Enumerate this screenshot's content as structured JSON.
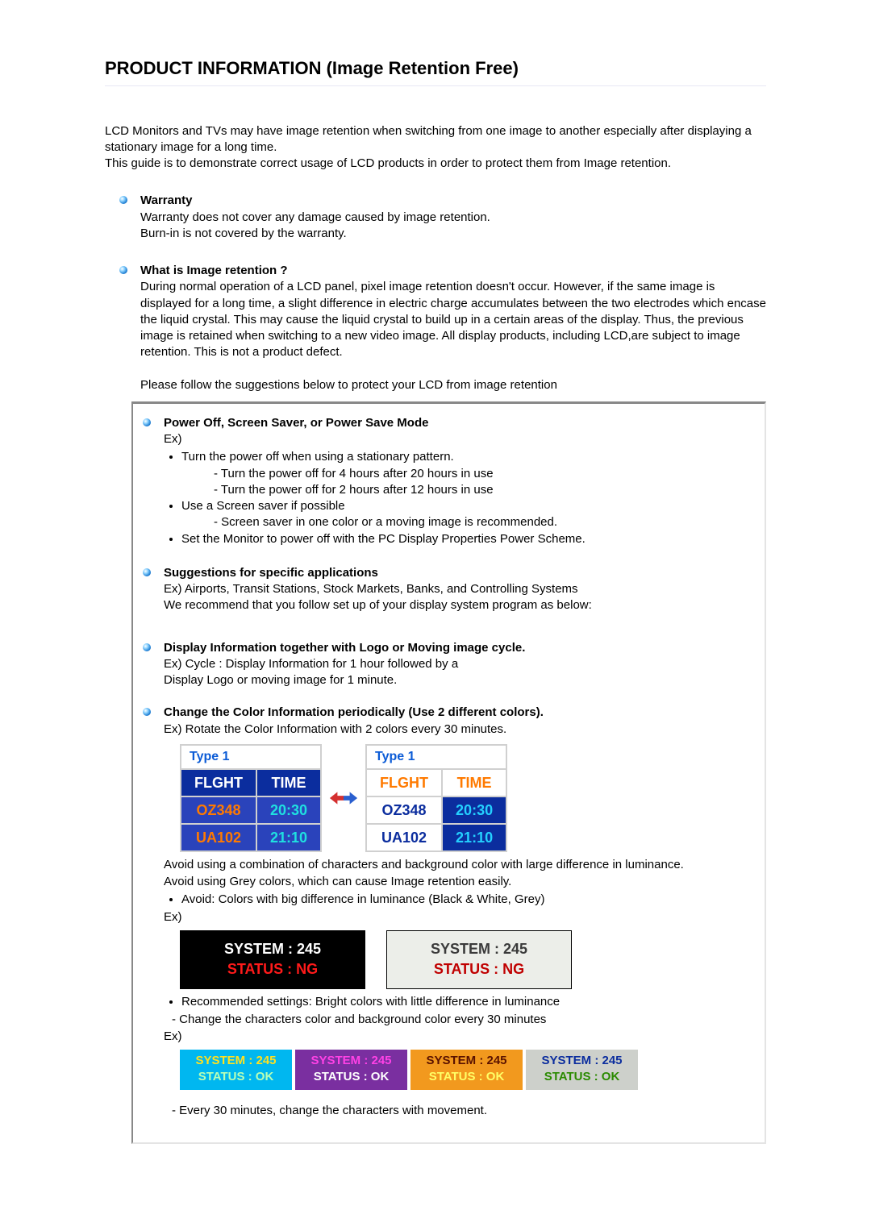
{
  "title": "PRODUCT INFORMATION (Image Retention Free)",
  "intro": {
    "p1": "LCD Monitors and TVs may have image retention when switching from one image to another especially after displaying a stationary image for a long time.",
    "p2": "This guide is to demonstrate correct usage of LCD products in order to protect them from Image retention."
  },
  "warranty": {
    "title": "Warranty",
    "l1": "Warranty does not cover any damage caused by image retention.",
    "l2": "Burn-in is not covered by the warranty."
  },
  "what_is": {
    "title": "What is Image retention ?",
    "body": "During normal operation of a LCD panel, pixel image retention doesn't occur. However, if the same image is displayed for a long time, a slight difference in electric charge accumulates between the two electrodes which encase the liquid crystal. This may cause the liquid crystal to build up in a certain areas of the display. Thus, the previous image is retained when switching to a new video image. All display products, including LCD,are subject to image retention. This is not a product defect."
  },
  "follow": "Please follow the suggestions below to protect your LCD from image retention",
  "guide": {
    "sec1": {
      "title": "Power Off, Screen Saver, or Power Save Mode",
      "ex": "Ex)",
      "b1": "Turn the power off when using a stationary pattern.",
      "b1d1": "- Turn the power off for 4 hours after 20 hours in use",
      "b1d2": "- Turn the power off for 2 hours after 12 hours in use",
      "b2": "Use a Screen saver if possible",
      "b2d1": "- Screen saver in one color or a moving image is recommended.",
      "b3": "Set the Monitor to power off with the PC Display Properties Power Scheme."
    },
    "sec2": {
      "title": "Suggestions for specific applications",
      "l1": "Ex) Airports, Transit Stations, Stock Markets, Banks, and Controlling Systems",
      "l2": "We recommend that you follow set up of your display system program as below:"
    },
    "sec3": {
      "title": "Display Information together with Logo or Moving image cycle.",
      "l1": "Ex) Cycle : Display Information for 1 hour followed by a",
      "l2": "Display Logo or moving image for 1 minute."
    },
    "sec4": {
      "title": "Change the Color Information periodically (Use 2 different colors).",
      "l1": "Ex) Rotate the Color Information with 2 colors every 30 minutes."
    },
    "type_label_left": "Type 1",
    "type_label_right": "Type 1",
    "table": {
      "h1": "FLGHT",
      "h2": "TIME",
      "r1c1": "OZ348",
      "r1c2": "20:30",
      "r2c1": "UA102",
      "r2c2": "21:10"
    },
    "avoid_p1": "Avoid using a combination of characters and background color with large difference in luminance.",
    "avoid_p2": "Avoid using Grey colors, which can cause Image retention easily.",
    "avoid_b1": "Avoid: Colors with big difference in luminance (Black & White, Grey)",
    "avoid_ex": "Ex)",
    "lum": {
      "l1": "SYSTEM : 245",
      "l2": "STATUS : NG"
    },
    "rec_b1": "Recommended settings: Bright colors with little difference in luminance",
    "rec_d1": "- Change the characters color and background color every 30 minutes",
    "rec_ex": "Ex)",
    "rec": {
      "l1": "SYSTEM : 245",
      "l2": "STATUS : OK"
    },
    "rec_d2": "- Every 30 minutes, change the characters with movement."
  }
}
